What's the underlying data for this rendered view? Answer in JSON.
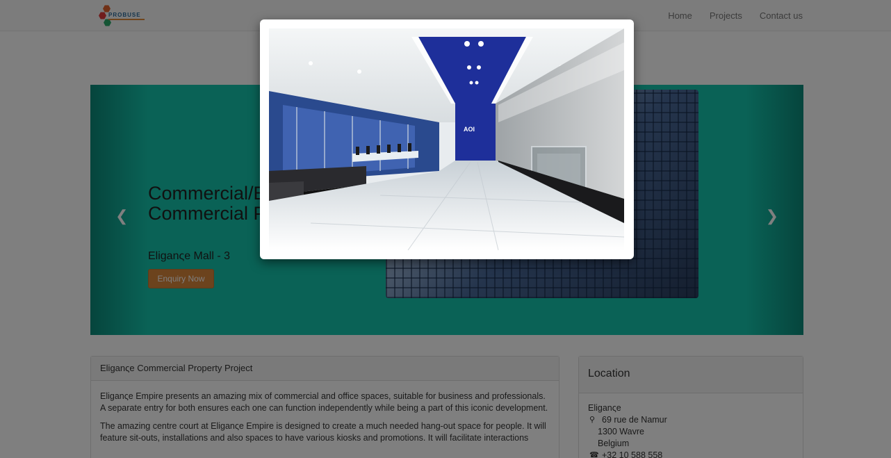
{
  "nav": {
    "logo_text": "PROBUSE",
    "items": [
      "Home",
      "Projects",
      "Contact us"
    ]
  },
  "hero": {
    "title": "Commercial/Eliance Commercial Property Project",
    "subtitle": "Eliganςe Mall - 3",
    "button": "Enquiry Now"
  },
  "panel_main": {
    "heading": "Eliganςe Commercial Property Project",
    "paragraphs": [
      "Eliganςe Empire presents an amazing mix of commercial and office spaces, suitable for business and professionals. A separate entry for both ensures each one can function independently while being a part of this iconic development.",
      "The amazing centre court at Eliganςe Empire is designed to create a much needed hang-out space for people. It will feature sit-outs, installations and also spaces to have various kiosks and promotions. It will facilitate interactions"
    ]
  },
  "panel_location": {
    "heading": "Location",
    "name": "Eliganςe",
    "street": "69 rue de Namur",
    "city": "1300 Wavre",
    "country": "Belgium",
    "phone": "+32 10 588 558"
  },
  "colors": {
    "hero_bg": "#14c4ac",
    "button": "#d9863a",
    "accent_blue": "#1e2f9a"
  },
  "icons": {
    "prev": "chevron-left-icon",
    "next": "chevron-right-icon",
    "marker": "map-marker-icon",
    "phone": "phone-icon"
  }
}
